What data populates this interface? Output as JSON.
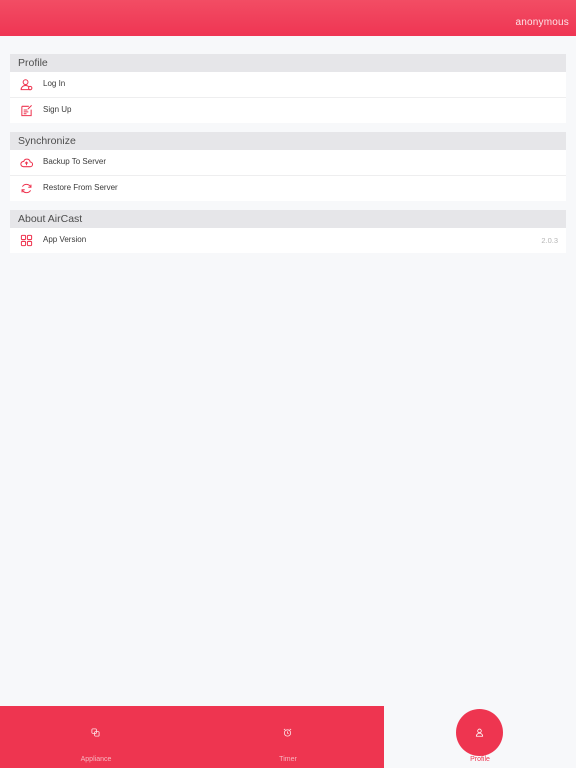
{
  "header": {
    "username": "anonymous",
    "accent_color": "#ef3553"
  },
  "sections": [
    {
      "title": "Profile",
      "items": [
        {
          "label": "Log In",
          "icon": "user-login-icon"
        },
        {
          "label": "Sign Up",
          "icon": "signup-form-icon"
        }
      ]
    },
    {
      "title": "Synchronize",
      "items": [
        {
          "label": "Backup To Server",
          "icon": "cloud-upload-icon"
        },
        {
          "label": "Restore From Server",
          "icon": "refresh-icon"
        }
      ]
    },
    {
      "title": "About AirCast",
      "items": [
        {
          "label": "App Version",
          "value": "2.0.3",
          "icon": "apps-grid-icon"
        }
      ]
    }
  ],
  "tabbar": {
    "tabs": [
      {
        "label": "Appliance",
        "icon": "appliance-icon"
      },
      {
        "label": "Timer",
        "icon": "alarm-clock-icon"
      },
      {
        "label": "Profile",
        "icon": "profile-icon",
        "selected": true
      }
    ]
  }
}
